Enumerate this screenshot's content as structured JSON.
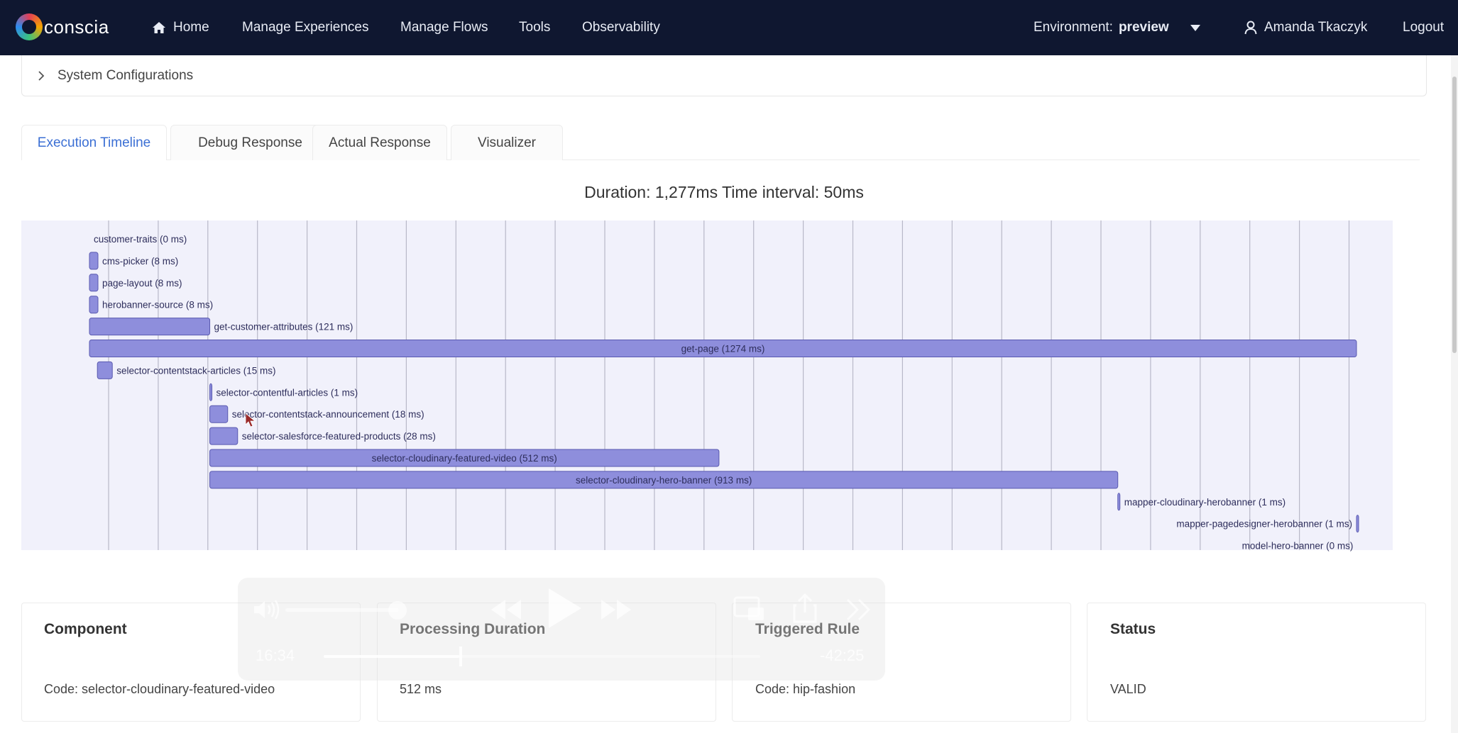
{
  "app": {
    "logo_text": "conscia"
  },
  "nav": {
    "items": [
      {
        "label": "Home",
        "icon": "home-icon"
      },
      {
        "label": "Manage Experiences"
      },
      {
        "label": "Manage Flows"
      },
      {
        "label": "Tools"
      },
      {
        "label": "Observability"
      }
    ],
    "environment_label": "Environment:",
    "environment_value": "preview",
    "user_name": "Amanda Tkaczyk",
    "logout_label": "Logout",
    "background": "#0f1730"
  },
  "config": {
    "label": "System Configurations"
  },
  "tabs": [
    {
      "label": "Execution Timeline",
      "active": true
    },
    {
      "label": "Debug Response",
      "active": false
    },
    {
      "label": "Actual Response",
      "active": false
    },
    {
      "label": "Visualizer",
      "active": false
    }
  ],
  "chart_data": {
    "type": "gantt",
    "title": "Duration: 1,277ms Time interval: 50ms",
    "total_ms": 1277,
    "interval_ms": 50,
    "bar_color": "#8e8edc",
    "bar_stroke": "#5a5ab0",
    "background": "#f1f1fb",
    "tasks": [
      {
        "label": "customer-traits (0 ms)",
        "start": 0,
        "duration": 0
      },
      {
        "label": "cms-picker (8 ms)",
        "start": 0,
        "duration": 8
      },
      {
        "label": "page-layout (8 ms)",
        "start": 0,
        "duration": 8
      },
      {
        "label": "herobanner-source (8 ms)",
        "start": 0,
        "duration": 8
      },
      {
        "label": "get-customer-attributes (121 ms)",
        "start": 0,
        "duration": 121
      },
      {
        "label": "get-page (1274 ms)",
        "start": 0,
        "duration": 1274
      },
      {
        "label": "selector-contentstack-articles (15 ms)",
        "start": 8,
        "duration": 15
      },
      {
        "label": "selector-contentful-articles (1 ms)",
        "start": 121,
        "duration": 1
      },
      {
        "label": "selector-contentstack-announcement (18 ms)",
        "start": 121,
        "duration": 18
      },
      {
        "label": "selector-salesforce-featured-products (28 ms)",
        "start": 121,
        "duration": 28
      },
      {
        "label": "selector-cloudinary-featured-video (512 ms)",
        "start": 121,
        "duration": 512
      },
      {
        "label": "selector-cloudinary-hero-banner (913 ms)",
        "start": 121,
        "duration": 913
      },
      {
        "label": "mapper-cloudinary-herobanner (1 ms)",
        "start": 1034,
        "duration": 1
      },
      {
        "label": "mapper-pagedesigner-herobanner (1 ms)",
        "start": 1274,
        "duration": 1
      },
      {
        "label": "model-hero-banner (0 ms)",
        "start": 1275,
        "duration": 0
      }
    ]
  },
  "details": {
    "headers": [
      "Component",
      "Processing Duration",
      "Triggered Rule",
      "Status"
    ],
    "values": [
      "Code: selector-cloudinary-featured-video",
      "512 ms",
      "Code: hip-fashion",
      "VALID"
    ]
  },
  "player": {
    "current_time": "16:34",
    "remaining_time": "-42:25",
    "progress_fraction": 0.31,
    "volume_fraction": 0.75
  }
}
